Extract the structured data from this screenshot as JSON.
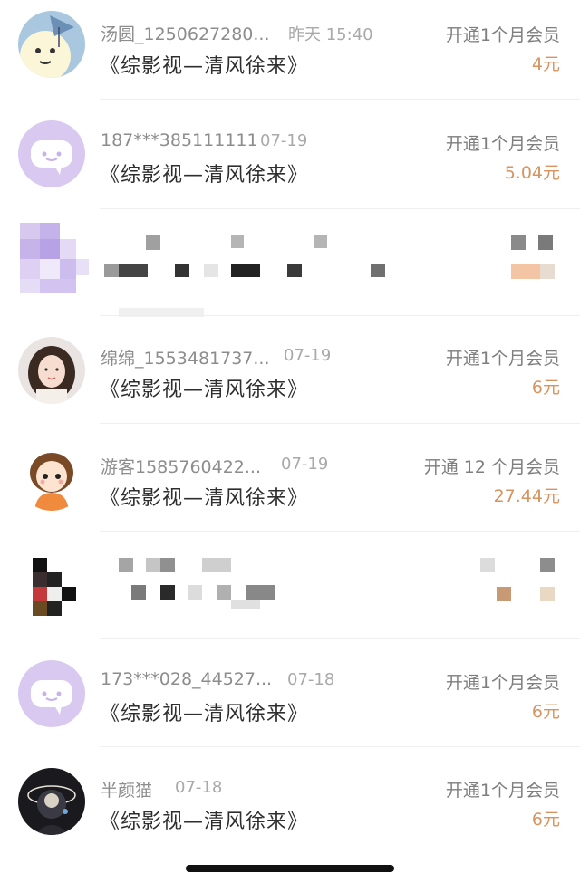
{
  "records": [
    {
      "name": "汤圆_1250627280...",
      "date": "昨天 15:40",
      "title": "《综影视—清风徐来》",
      "desc": "开通1个月会员",
      "amount": "4元",
      "avatar": "cartoon-moon-avatar-icon"
    },
    {
      "name": "187***385111111",
      "date": "07-19",
      "title": "《综影视—清风徐来》",
      "desc": "开通1个月会员",
      "amount": "5.04元",
      "avatar": "default-chat-avatar-icon"
    },
    {
      "blurred": true,
      "avatar": "pixelated-avatar"
    },
    {
      "name": "绵绵_1553481737...",
      "date": "07-19",
      "title": "《综影视—清风徐来》",
      "desc": "开通1个月会员",
      "amount": "6元",
      "avatar": "girl-photo-avatar-icon"
    },
    {
      "name": "游客1585760422...",
      "date": "07-19",
      "title": "《综影视—清风徐来》",
      "desc": "开通 12 个月会员",
      "amount": "27.44元",
      "avatar": "cartoon-girl-avatar-icon"
    },
    {
      "blurred": true,
      "avatar": "pixelated-avatar"
    },
    {
      "name": "173***028_44527...",
      "date": "07-18",
      "title": "《综影视—清风徐来》",
      "desc": "开通1个月会员",
      "amount": "6元",
      "avatar": "default-chat-avatar-icon"
    },
    {
      "name": "半颜猫",
      "date": "07-18",
      "title": "《综影视—清风徐来》",
      "desc": "开通1个月会员",
      "amount": "6元",
      "avatar": "dark-art-avatar-icon"
    }
  ],
  "colors": {
    "amount": "#d59460",
    "name": "#8d8d8d",
    "title": "#2e2e2e",
    "default_avatar_bg": "#d9c9f0"
  }
}
